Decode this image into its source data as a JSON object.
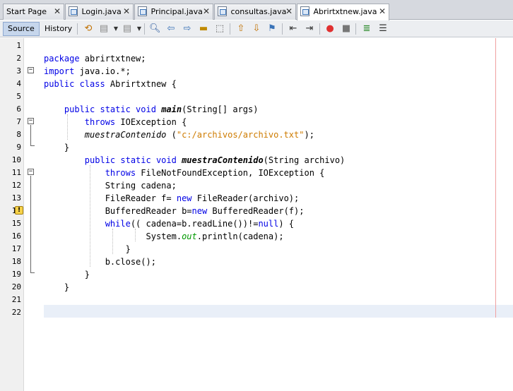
{
  "tabs": [
    {
      "label": "Start Page",
      "icon": "start-page-icon",
      "active": false
    },
    {
      "label": "Login.java",
      "icon": "java-file-icon",
      "active": false
    },
    {
      "label": "Principal.java",
      "icon": "java-file-icon",
      "active": false
    },
    {
      "label": "consultas.java",
      "icon": "java-file-icon",
      "active": false
    },
    {
      "label": "Abrirtxtnew.java",
      "icon": "java-file-icon",
      "active": true
    }
  ],
  "close_glyph": "✕",
  "toolbar": {
    "source_label": "Source",
    "history_label": "History"
  },
  "editor": {
    "line_numbers": [
      "1",
      "2",
      "3",
      "4",
      "5",
      "6",
      "7",
      "8",
      "9",
      "10",
      "11",
      "12",
      "13",
      "14",
      "15",
      "16",
      "17",
      "18",
      "19",
      "20",
      "21",
      "22"
    ],
    "warning_line": "14",
    "current_line": "22",
    "lines": [
      [],
      [
        {
          "t": "package",
          "c": "kw"
        },
        {
          "t": " abrirtxtnew;"
        }
      ],
      [
        {
          "t": "import",
          "c": "kw"
        },
        {
          "t": " java.io.*;"
        }
      ],
      [
        {
          "t": "public class",
          "c": "kw"
        },
        {
          "t": " Abrirtxtnew {"
        }
      ],
      [],
      [
        {
          "t": "    "
        },
        {
          "t": "public static void",
          "c": "kw"
        },
        {
          "t": " "
        },
        {
          "t": "main",
          "c": "bi"
        },
        {
          "t": "(String[] args)"
        }
      ],
      [
        {
          "t": "        "
        },
        {
          "t": "throws",
          "c": "kw"
        },
        {
          "t": " IOException {"
        }
      ],
      [
        {
          "t": "        "
        },
        {
          "t": "muestraContenido",
          "c": "it"
        },
        {
          "t": " ("
        },
        {
          "t": "\"c:/archivos/archivo.txt\"",
          "c": "str"
        },
        {
          "t": ");"
        }
      ],
      [
        {
          "t": "    }"
        }
      ],
      [
        {
          "t": "        "
        },
        {
          "t": "public static void",
          "c": "kw"
        },
        {
          "t": " "
        },
        {
          "t": "muestraContenido",
          "c": "bi"
        },
        {
          "t": "(String archivo)"
        }
      ],
      [
        {
          "t": "            "
        },
        {
          "t": "throws",
          "c": "kw"
        },
        {
          "t": " FileNotFoundException, IOException {"
        }
      ],
      [
        {
          "t": "            String cadena;"
        }
      ],
      [
        {
          "t": "            FileReader f= "
        },
        {
          "t": "new",
          "c": "kw"
        },
        {
          "t": " FileReader(archivo);"
        }
      ],
      [
        {
          "t": "            BufferedReader b="
        },
        {
          "t": "new",
          "c": "kw"
        },
        {
          "t": " BufferedReader(f);"
        }
      ],
      [
        {
          "t": "            "
        },
        {
          "t": "while",
          "c": "kw"
        },
        {
          "t": "(( cadena=b.readLine())!="
        },
        {
          "t": "null",
          "c": "kw"
        },
        {
          "t": ") {"
        }
      ],
      [
        {
          "t": "                    System."
        },
        {
          "t": "out",
          "c": "fld"
        },
        {
          "t": ".println(cadena);"
        }
      ],
      [
        {
          "t": "                }"
        }
      ],
      [
        {
          "t": "            b.close();"
        }
      ],
      [
        {
          "t": "        }"
        }
      ],
      [
        {
          "t": "    }"
        }
      ],
      [],
      []
    ]
  }
}
